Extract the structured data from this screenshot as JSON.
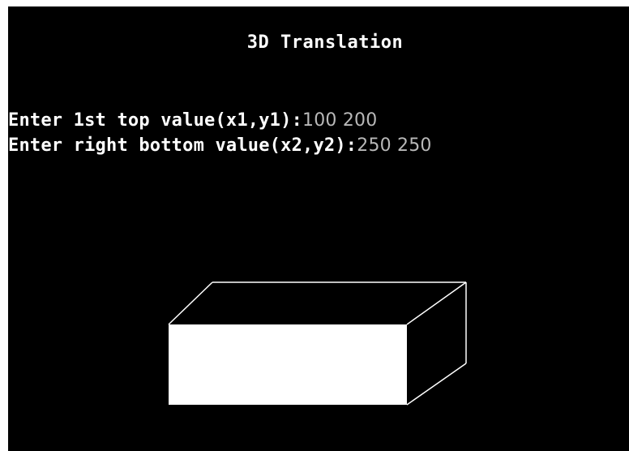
{
  "window": {
    "title": "3D Translation",
    "background_color": "#000000",
    "text_color": "#ffffff",
    "input_text_color": "#b8b8b8"
  },
  "prompts": [
    {
      "label": "Enter 1st top value(x1,y1):",
      "value": "100 200"
    },
    {
      "label": "Enter right bottom value(x2,y2):",
      "value": "250 250"
    }
  ],
  "shape": {
    "type": "3D box",
    "front_face_color": "#ffffff",
    "edge_color": "#ffffff"
  }
}
